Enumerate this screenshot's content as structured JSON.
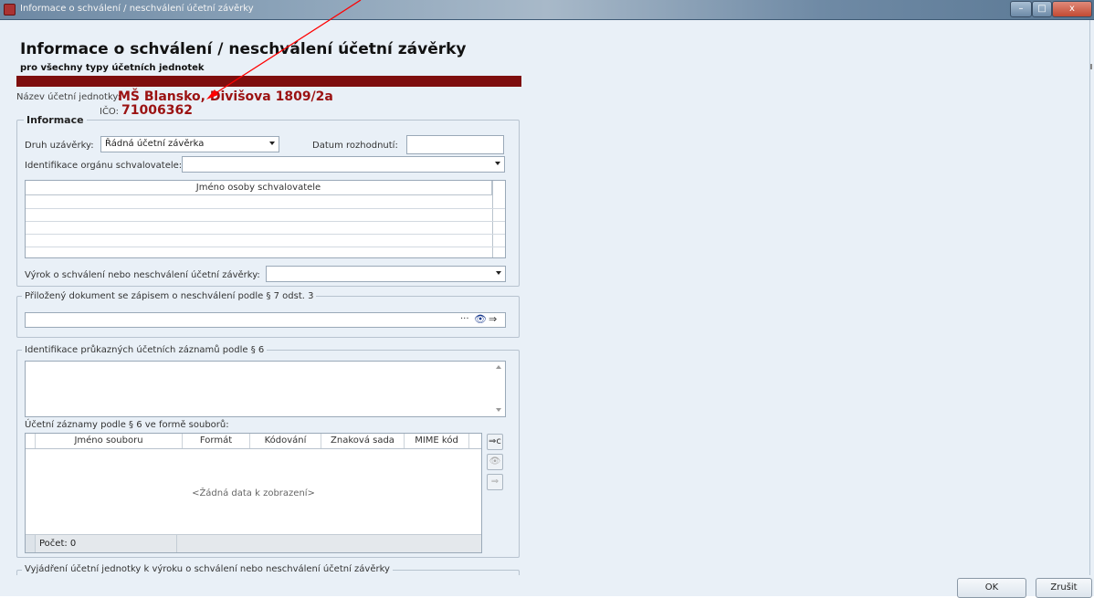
{
  "window": {
    "title": "Informace o schválení / neschválení účetní závěrky",
    "min_glyph": "–",
    "max_glyph": "□",
    "close_glyph": "x"
  },
  "header": {
    "title": "Informace o schválení / neschválení účetní závěrky",
    "subtitle": "pro všechny typy účetních jednotek"
  },
  "entity": {
    "name_label": "Název účetní jednotky:",
    "name_value": "MŠ Blansko, Divišova 1809/2a",
    "ico_label": "IČO:",
    "ico_value": "71006362"
  },
  "info_group": {
    "caption": "Informace",
    "type_label": "Druh uzávěrky:",
    "type_value": "Řádná účetní závěrka",
    "decision_date_label": "Datum rozhodnutí:",
    "decision_date_value": "",
    "approver_org_label": "Identifikace orgánu schvalovatele:",
    "approver_org_value": "",
    "approver_grid_header": "Jméno osoby schvalovatele",
    "verdict_label": "Výrok o schválení nebo neschválení účetní závěrky:",
    "verdict_value": ""
  },
  "attached_doc_group": {
    "caption": "Přiložený dokument se zápisem o neschválení podle § 7 odst. 3",
    "value": "",
    "browse_glyph": "···",
    "view_glyph": "👁",
    "export_glyph": "⇒"
  },
  "records_group": {
    "caption": "Identifikace průkazných účetních záznamů podle § 6",
    "text_value": "",
    "files_label": "Účetní záznamy podle § 6 ve formě souborů:",
    "columns": [
      "Jméno souboru",
      "Formát",
      "Kódování",
      "Znaková sada",
      "MIME kód"
    ],
    "empty_text": "<Žádná data k zobrazení>",
    "count_label": "Počet: 0",
    "add_glyph": "⇒c",
    "view_glyph": "👁",
    "export_glyph": "⇒"
  },
  "statement_group": {
    "caption": "Vyjádření účetní jednotky k výroku o schválení nebo neschválení účetní závěrky"
  },
  "footer": {
    "ok_label": "OK",
    "cancel_label": "Zrušit"
  },
  "colors": {
    "accent_dark_red": "#7e0e0e",
    "entity_text_red": "#9b1212",
    "annotation_arrow": "#ff0000",
    "background": "#e9f0f7"
  }
}
